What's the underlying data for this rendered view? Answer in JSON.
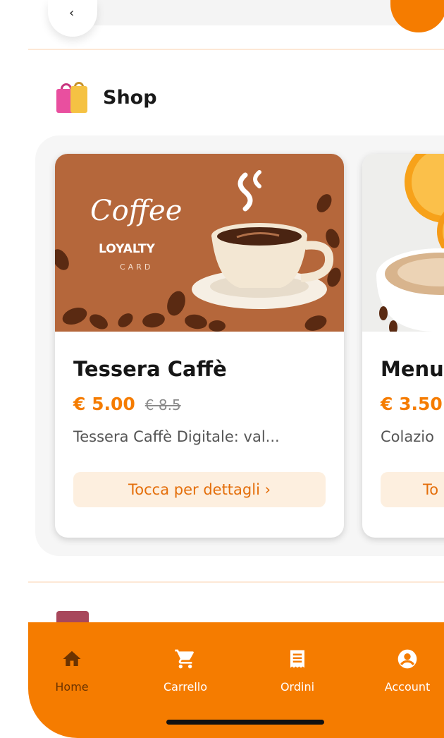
{
  "shop": {
    "title": "Shop"
  },
  "products": [
    {
      "title": "Tessera Caffè",
      "price": "€ 5.00",
      "old_price": "€ 8.5",
      "description": "Tessera Caffè Digitale: val...",
      "button_label": "Tocca per dettagli ›",
      "image_text": {
        "script": "Coffee",
        "loyalty": "LOYALTY",
        "card": "CARD"
      }
    },
    {
      "title": "Menu",
      "price": "€ 3.50",
      "description": "Colazio",
      "button_label": "To"
    }
  ],
  "bottom_nav": [
    {
      "label": "Home",
      "icon": "home-icon",
      "active": true
    },
    {
      "label": "Carrello",
      "icon": "cart-icon",
      "active": false
    },
    {
      "label": "Ordini",
      "icon": "receipt-icon",
      "active": false
    },
    {
      "label": "Account",
      "icon": "account-icon",
      "active": false
    }
  ],
  "colors": {
    "accent": "#f57c00",
    "accent_light": "#fdefdf",
    "nav_active_text": "#6b3300"
  }
}
